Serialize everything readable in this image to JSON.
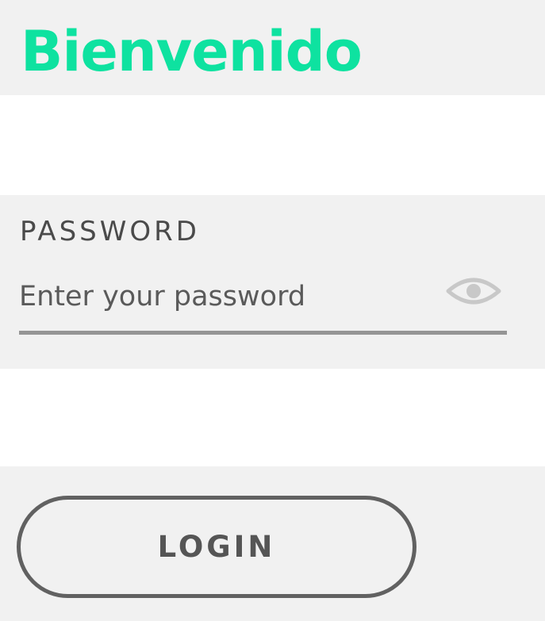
{
  "header": {
    "title": "Bienvenido",
    "title_color": "#0ee2a0",
    "background": "#f1f1f1"
  },
  "password": {
    "label": "PASSWORD",
    "value": "",
    "placeholder": "Enter your password",
    "toggle_icon": "eye-icon",
    "toggle_color": "#c8c8c8",
    "underline_color": "#959595"
  },
  "login": {
    "label": "LOGIN",
    "border_color": "#616161"
  }
}
